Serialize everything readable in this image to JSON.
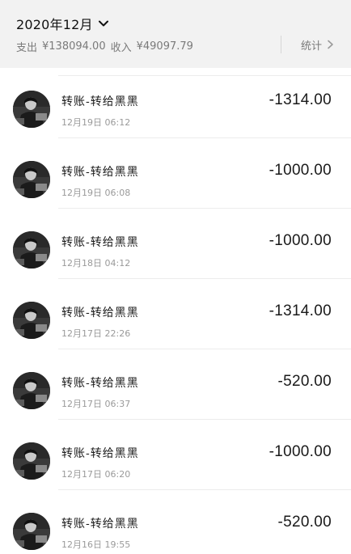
{
  "header": {
    "month": "2020年12月",
    "expense_label": "支出",
    "expense_value": "¥138094.00",
    "income_label": "收入",
    "income_value": "¥49097.79",
    "stats_label": "统计"
  },
  "colors": {
    "header_bg": "#f2f2f2",
    "amount": "#1a1a1a",
    "secondary_text": "#9a9a9a"
  },
  "icons": {
    "month_toggle": "chevron-down-icon",
    "stats": "chevron-right-icon",
    "avatar": "user-avatar"
  },
  "transactions": [
    {
      "title": "转账-转给黑黑",
      "time": "12月19日 06:12",
      "amount": "-1314.00"
    },
    {
      "title": "转账-转给黑黑",
      "time": "12月19日 06:08",
      "amount": "-1000.00"
    },
    {
      "title": "转账-转给黑黑",
      "time": "12月18日 04:12",
      "amount": "-1000.00"
    },
    {
      "title": "转账-转给黑黑",
      "time": "12月17日 22:26",
      "amount": "-1314.00"
    },
    {
      "title": "转账-转给黑黑",
      "time": "12月17日 06:37",
      "amount": "-520.00"
    },
    {
      "title": "转账-转给黑黑",
      "time": "12月17日 06:20",
      "amount": "-1000.00"
    },
    {
      "title": "转账-转给黑黑",
      "time": "12月16日 19:55",
      "amount": "-520.00"
    }
  ]
}
